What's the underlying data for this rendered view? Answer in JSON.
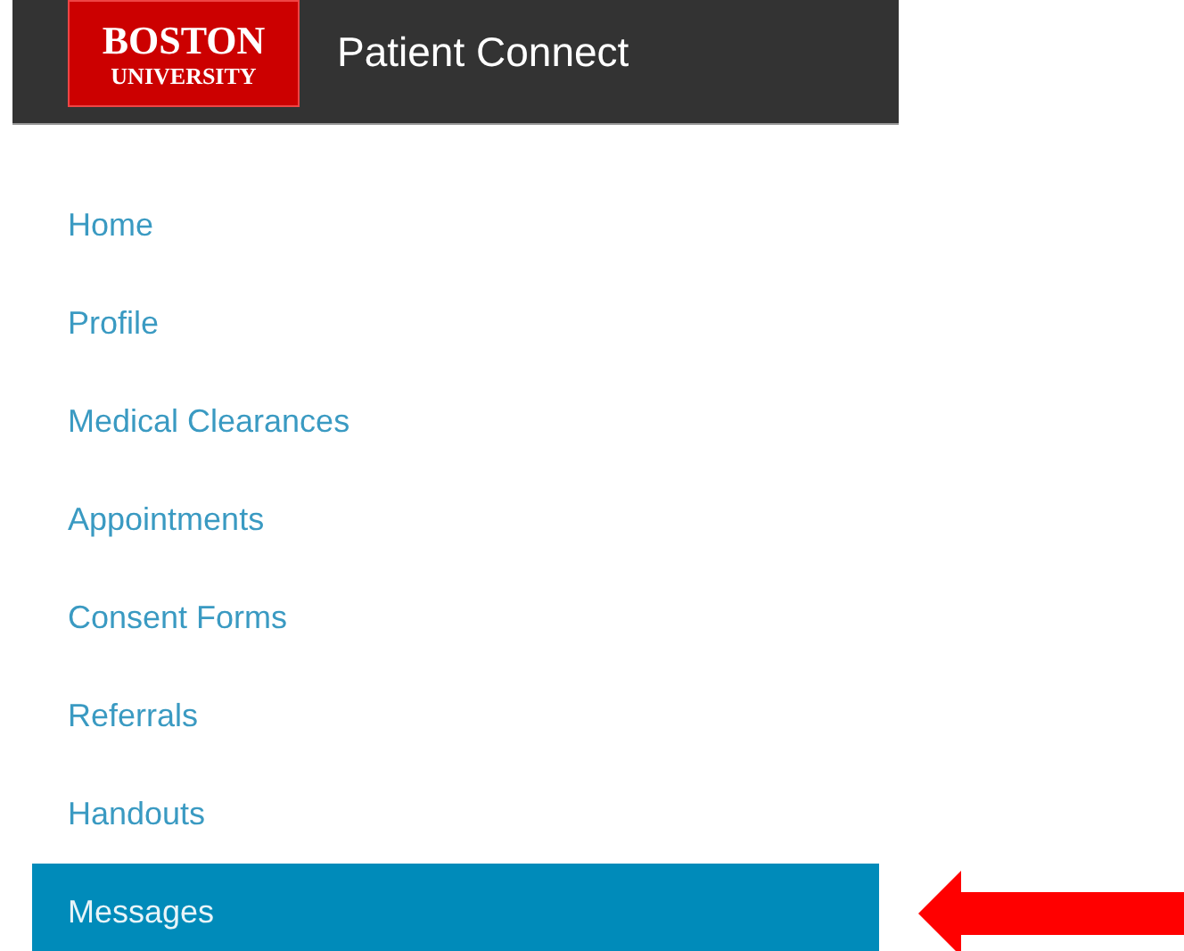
{
  "header": {
    "logo": {
      "line_1": "BOSTON",
      "line_2": "UNIVERSITY"
    },
    "title": "Patient Connect"
  },
  "nav": {
    "items": [
      {
        "label": "Home",
        "selected": false
      },
      {
        "label": "Profile",
        "selected": false
      },
      {
        "label": "Medical Clearances",
        "selected": false
      },
      {
        "label": "Appointments",
        "selected": false
      },
      {
        "label": "Consent Forms",
        "selected": false
      },
      {
        "label": "Referrals",
        "selected": false
      },
      {
        "label": "Handouts",
        "selected": false
      },
      {
        "label": "Messages",
        "selected": true
      }
    ]
  }
}
